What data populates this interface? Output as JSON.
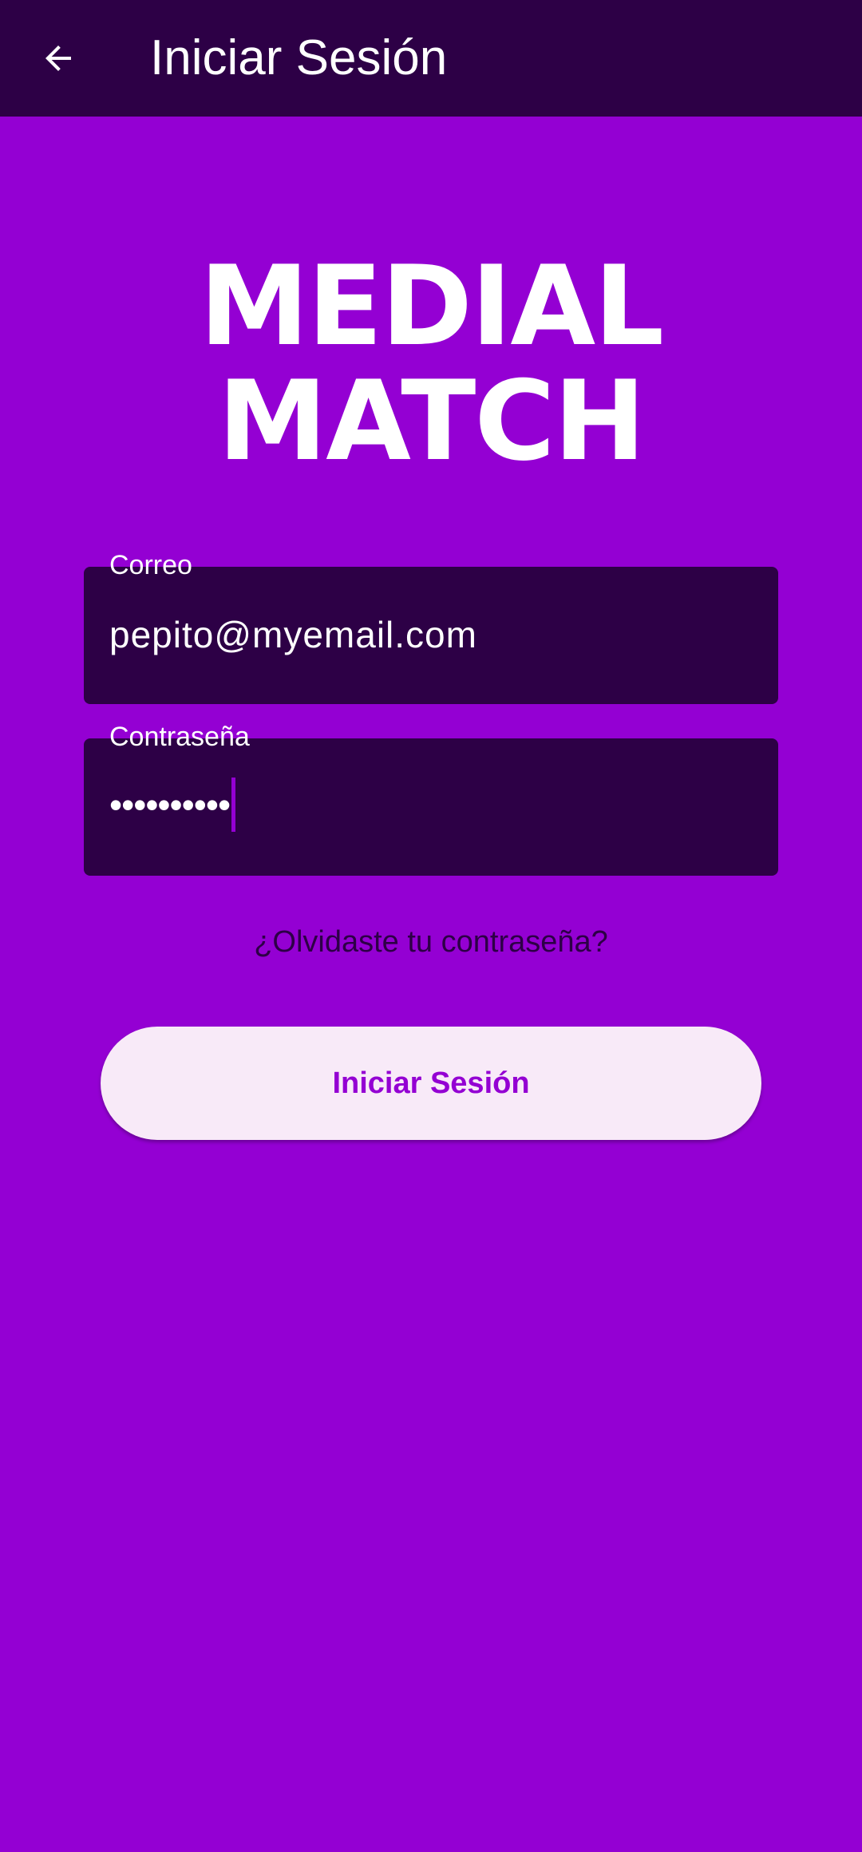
{
  "app_bar": {
    "title": "Iniciar Sesión",
    "back_icon": "arrow-back-icon"
  },
  "logo": {
    "line1": "MEDIAL",
    "line2": "MATCH"
  },
  "form": {
    "email": {
      "label": "Correo",
      "value": "pepito@myemail.com"
    },
    "password": {
      "label": "Contraseña",
      "masked_value": "••••••••••"
    },
    "forgot_password_link": "¿Olvidaste tu contraseña?",
    "submit_label": "Iniciar Sesión"
  },
  "colors": {
    "background": "#9400d3",
    "app_bar": "#2d0046",
    "field_background": "#2d0046",
    "button_background": "#f8eaf8",
    "button_text": "#9400d3"
  }
}
